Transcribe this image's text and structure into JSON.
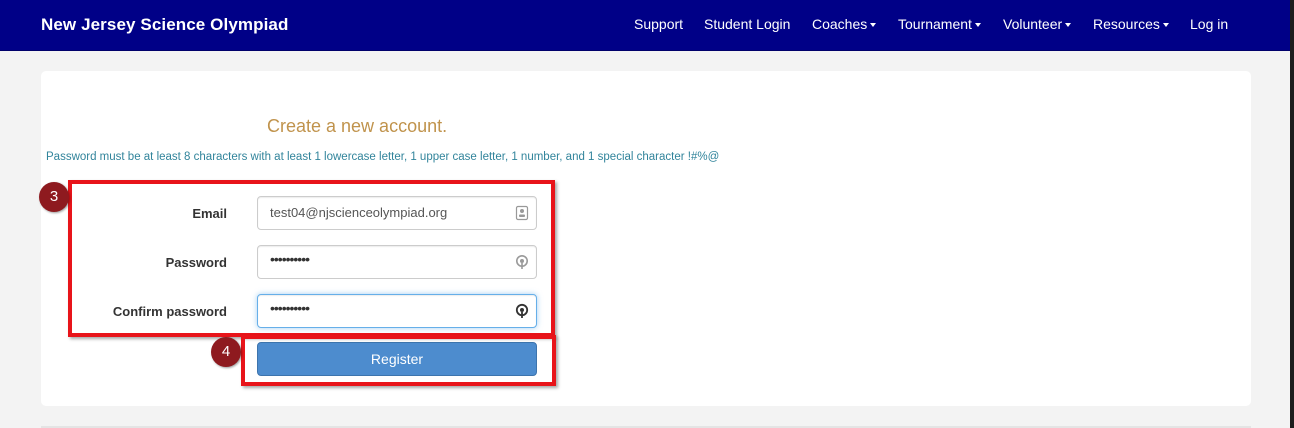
{
  "header": {
    "brand": "New Jersey Science Olympiad",
    "nav": [
      {
        "label": "Support",
        "dropdown": false
      },
      {
        "label": "Student Login",
        "dropdown": false
      },
      {
        "label": "Coaches",
        "dropdown": true
      },
      {
        "label": "Tournament",
        "dropdown": true
      },
      {
        "label": "Volunteer",
        "dropdown": true
      },
      {
        "label": "Resources",
        "dropdown": true
      },
      {
        "label": "Log in",
        "dropdown": false
      }
    ]
  },
  "form": {
    "title": "Create a new account.",
    "password_hint": "Password must be at least 8 characters with at least 1 lowercase letter, 1 upper case letter, 1 number, and 1 special character !#%@",
    "email_label": "Email",
    "email_value": "test04@njscienceolympiad.org",
    "password_label": "Password",
    "password_value": "••••••••••",
    "confirm_label": "Confirm password",
    "confirm_value": "••••••••••",
    "register_label": "Register"
  },
  "annotations": {
    "step_fields": "3",
    "step_register": "4"
  },
  "colors": {
    "navbar": "#000087",
    "heading": "#c0934c",
    "hint": "#31849b",
    "button": "#4d8cce",
    "highlight": "#e8141a",
    "badge": "#8e1a1f"
  }
}
